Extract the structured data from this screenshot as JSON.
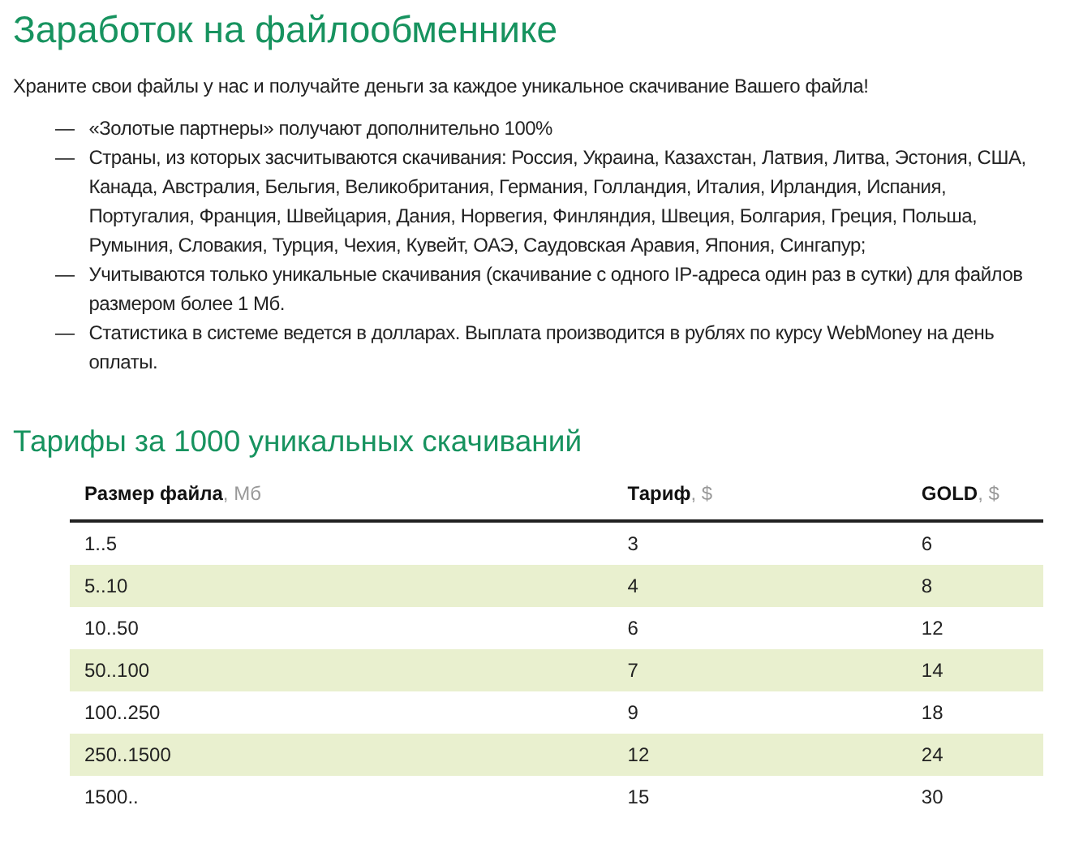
{
  "title": "Заработок на файлообменнике",
  "intro": "Храните свои файлы у нас и получайте деньги за каждое уникальное скачивание Вашего файла!",
  "list": [
    {
      "marker": "—",
      "text": "«Золотые партнеры» получают дополнительно 100%"
    },
    {
      "marker": "—",
      "text": "Страны, из которых засчитываются скачивания: Россия, Украина, Казахстан, Латвия, Литва, Эстония, США, Канада, Австралия, Бельгия, Великобритания, Германия, Голландия, Италия, Ирландия, Испания, Португалия, Франция, Швейцария, Дания, Норвегия, Финляндия, Швеция, Болгария, Греция, Польша, Румыния, Словакия, Турция, Чехия, Кувейт, ОАЭ, Саудовская Аравия, Япония, Сингапур;"
    },
    {
      "marker": "—",
      "text": "Учитываются только уникальные скачивания (скачивание с одного IP-адреса один раз в сутки) для файлов размером более 1 Мб."
    },
    {
      "marker": "—",
      "text": "Статистика в системе ведется в долларах. Выплата производится в рублях по курсу WebMoney на день оплаты."
    }
  ],
  "tariffs": {
    "title": "Тарифы за 1000 уникальных скачиваний",
    "columns": [
      "**Размер файла**, Мб",
      "**Тариф**, $",
      "**GOLD**, $"
    ],
    "rows": [
      [
        "1..5",
        "3",
        "6"
      ],
      [
        "5..10",
        "4",
        "8"
      ],
      [
        "10..50",
        "6",
        "12"
      ],
      [
        "50..100",
        "7",
        "14"
      ],
      [
        "100..250",
        "9",
        "18"
      ],
      [
        "250..1500",
        "12",
        "24"
      ],
      [
        "1500..",
        "15",
        "30"
      ]
    ]
  }
}
